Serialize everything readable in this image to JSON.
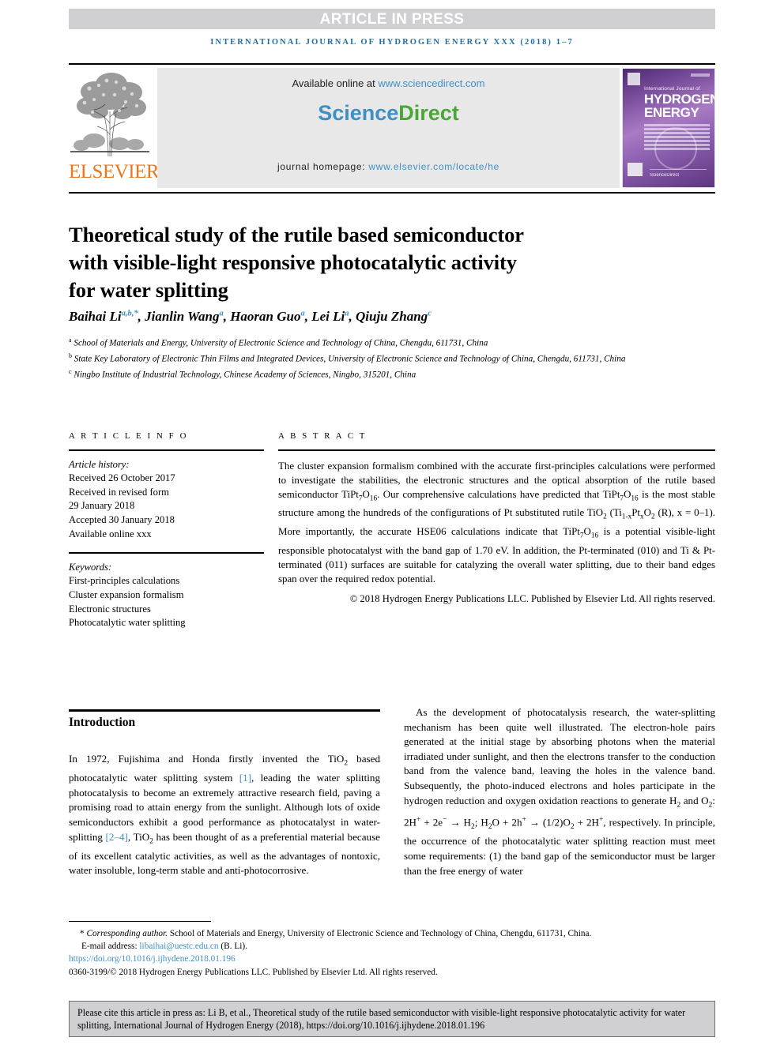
{
  "banner": {
    "article_in_press": "ARTICLE IN PRESS",
    "journal_line": "INTERNATIONAL JOURNAL OF HYDROGEN ENERGY XXX (2018) 1–7"
  },
  "masthead": {
    "publisher_name": "ELSEVIER",
    "available_online_prefix": "Available online at ",
    "sciencedirect_url": "www.sciencedirect.com",
    "sciencedirect_logo_a": "Science",
    "sciencedirect_logo_b": "Direct",
    "homepage_label": "journal homepage: ",
    "homepage_url": "www.elsevier.com/locate/he",
    "cover": {
      "subtitle": "International Journal of",
      "title_line1": "HYDROGEN",
      "title_line2": "ENERGY",
      "footer": "ScienceDirect"
    }
  },
  "article": {
    "title_line1": "Theoretical study of the rutile based semiconductor",
    "title_line2": "with visible-light responsive photocatalytic activity",
    "title_line3": "for water splitting",
    "authors": [
      {
        "name": "Baihai Li",
        "marks": "a,b,*"
      },
      {
        "name": "Jianlin Wang",
        "marks": "a"
      },
      {
        "name": "Haoran Guo",
        "marks": "a"
      },
      {
        "name": "Lei Li",
        "marks": "a"
      },
      {
        "name": "Qiuju Zhang",
        "marks": "c"
      }
    ],
    "affiliations": [
      {
        "mark": "a",
        "text": "School of Materials and Energy, University of Electronic Science and Technology of China, Chengdu, 611731, China"
      },
      {
        "mark": "b",
        "text": "State Key Laboratory of Electronic Thin Films and Integrated Devices, University of Electronic Science and Technology of China, Chengdu, 611731, China"
      },
      {
        "mark": "c",
        "text": "Ningbo Institute of Industrial Technology, Chinese Academy of Sciences, Ningbo, 315201, China"
      }
    ]
  },
  "article_info": {
    "label": "A R T I C L E   I N F O",
    "history_label": "Article history:",
    "received": "Received 26 October 2017",
    "revised_label": "Received in revised form",
    "revised_date": "29 January 2018",
    "accepted": "Accepted 30 January 2018",
    "available_online": "Available online xxx",
    "keywords_label": "Keywords:",
    "keywords": [
      "First-principles calculations",
      "Cluster expansion formalism",
      "Electronic structures",
      "Photocatalytic water splitting"
    ]
  },
  "abstract": {
    "label": "A B S T R A C T",
    "paragraph_parts": [
      "The cluster expansion formalism combined with the accurate first-principles calculations were performed to investigate the stabilities, the electronic structures and the optical absorption of the rutile based semiconductor TiPt",
      "7",
      "O",
      "16",
      ". Our comprehensive calculations have predicted that TiPt",
      "7",
      "O",
      "16",
      " is the most stable structure among the hundreds of the configurations of Pt substituted rutile TiO",
      "2",
      " (Ti",
      "1-x",
      "Pt",
      "x",
      "O",
      "2",
      " (R), x = 0–1). More importantly, the accurate HSE06 calculations indicate that TiPt",
      "7",
      "O",
      "16",
      " is a potential visible-light responsible photocatalyst with the band gap of 1.70 eV. In addition, the Pt-terminated (010) and Ti & Pt-terminated (011) surfaces are suitable for catalyzing the overall water splitting, due to their band edges span over the required redox potential."
    ],
    "copyright": "© 2018 Hydrogen Energy Publications LLC. Published by Elsevier Ltd. All rights reserved."
  },
  "introduction": {
    "heading": "Introduction",
    "left_column": {
      "before_ref1": "In 1972, Fujishima and Honda firstly invented the TiO",
      "sub1": "2",
      "after_sub1": " based photocatalytic water splitting system ",
      "ref1": "[1]",
      "after_ref1": ", leading the water splitting photocatalysis to become an extremely attractive research field, paving a promising road to attain energy from the sunlight. Although lots of oxide semiconductors exhibit a good performance as photocatalyst in water-splitting ",
      "ref2": "[2–4]",
      "after_ref2": ", TiO",
      "sub2": "2",
      "tail": " has been thought of as a preferential material because of its excellent catalytic activities, as well as the advantages of nontoxic, water insoluble, long-term stable and anti-photocorrosive."
    },
    "right_column": {
      "p1_a": "As the development of photocatalysis research, the water-splitting mechanism has been quite well illustrated. The electron-hole pairs generated at the initial stage by absorbing photons when the material irradiated under sunlight, and then the electrons transfer to the conduction band from the valence band, leaving the holes in the valence band. Subsequently, the photo-induced electrons and holes participate in the hydrogen reduction and oxygen oxidation reactions to generate H",
      "s1": "2",
      "p1_b": " and O",
      "s2": "2",
      "p1_c": ": 2H",
      "u1": "+",
      "p1_d": " + 2e",
      "u2": "−",
      "p1_e": " → H",
      "s3": "2",
      "p1_f": "; H",
      "s4": "2",
      "p1_g": "O + 2h",
      "u3": "+",
      "p1_h": " → (1/2)O",
      "s5": "2",
      "p1_i": " + 2H",
      "u4": "+",
      "p1_j": ", respectively. In principle, the occurrence of the photocatalytic water splitting reaction must meet some requirements: (1) the band gap of the semiconductor must be larger than the free energy of water"
    }
  },
  "footnote": {
    "corresponding_marker": "*",
    "corresponding_italic": "Corresponding author.",
    "corresponding_rest": " School of Materials and Energy, University of Electronic Science and Technology of China, Chengdu, 611731, China.",
    "email_label": "E-mail address: ",
    "email": "libaihai@uestc.edu.cn",
    "email_owner": " (B. Li).",
    "doi": "https://doi.org/10.1016/j.ijhydene.2018.01.196",
    "issn_line": "0360-3199/© 2018 Hydrogen Energy Publications LLC. Published by Elsevier Ltd. All rights reserved."
  },
  "cite_box": {
    "text": "Please cite this article in press as: Li B, et al., Theoretical study of the rutile based semiconductor with visible-light responsive photocatalytic activity for water splitting, International Journal of Hydrogen Energy (2018), https://doi.org/10.1016/j.ijhydene.2018.01.196"
  },
  "colors": {
    "link_blue": "#3f8fc4",
    "journal_blue": "#1a6fa8",
    "elsevier_orange": "#e87722",
    "sciencedirect_green": "#4aa635",
    "banner_gray": "#d0d0d2",
    "panel_gray": "#e8e8e8"
  }
}
